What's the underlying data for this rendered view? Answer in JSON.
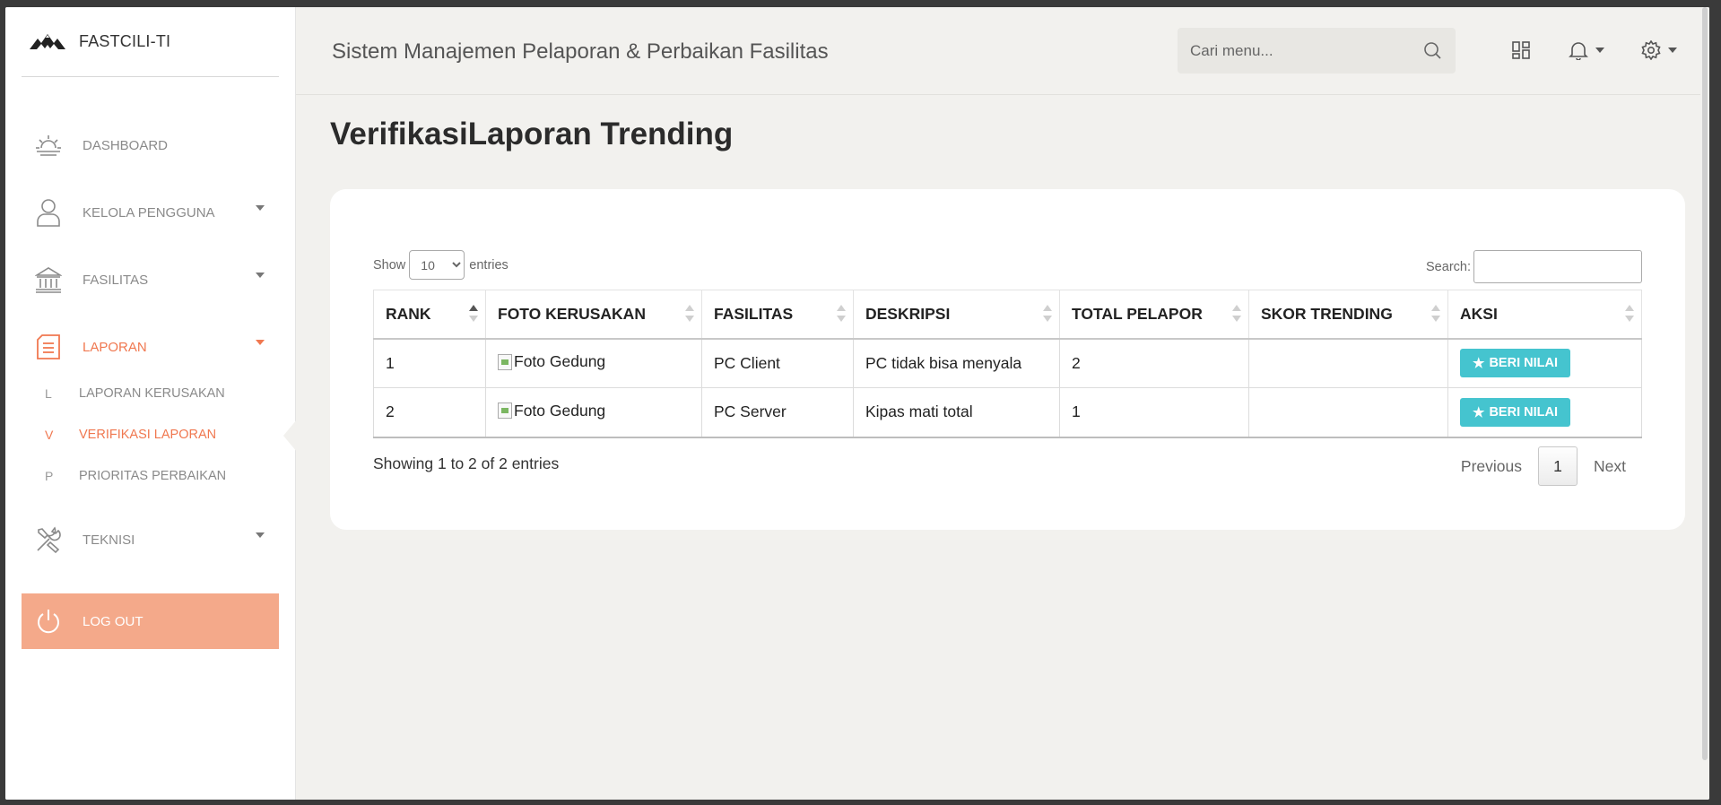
{
  "brand": {
    "name": "FASTCILI-TI",
    "logo_icon": "mountain-logo-icon"
  },
  "sidebar": {
    "items": [
      {
        "label": "DASHBOARD",
        "icon": "sunrise-icon"
      },
      {
        "label": "KELOLA PENGGUNA",
        "icon": "user-icon"
      },
      {
        "label": "FASILITAS",
        "icon": "building-icon"
      },
      {
        "label": "LAPORAN",
        "icon": "document-icon"
      },
      {
        "label": "TEKNISI",
        "icon": "tools-icon"
      }
    ],
    "sub_items": [
      {
        "letter": "L",
        "label": "LAPORAN KERUSAKAN"
      },
      {
        "letter": "V",
        "label": "VERIFIKASI LAPORAN"
      },
      {
        "letter": "P",
        "label": "PRIORITAS PERBAIKAN"
      }
    ],
    "logout_label": "LOG OUT"
  },
  "header": {
    "app_title": "Sistem Manajemen Pelaporan & Perbaikan Fasilitas",
    "search_placeholder": "Cari menu..."
  },
  "page": {
    "title": "VerifikasiLaporan Trending"
  },
  "table": {
    "length": {
      "show": "Show",
      "value": "10",
      "entries": "entries"
    },
    "search_label": "Search:",
    "columns": [
      "RANK",
      "FOTO KERUSAKAN",
      "FASILITAS",
      "DESKRIPSI",
      "TOTAL PELAPOR",
      "SKOR TRENDING",
      "AKSI"
    ],
    "rows": [
      {
        "rank": "1",
        "foto": "Foto Gedung",
        "fasilitas": "PC Client",
        "deskripsi": "PC tidak bisa menyala",
        "total": "2",
        "skor": "",
        "aksi": "BERI NILAI"
      },
      {
        "rank": "2",
        "foto": "Foto Gedung",
        "fasilitas": "PC Server",
        "deskripsi": "Kipas mati total",
        "total": "1",
        "skor": "",
        "aksi": "BERI NILAI"
      }
    ],
    "info": "Showing 1 to 2 of 2 entries",
    "pagination": {
      "previous": "Previous",
      "current": "1",
      "next": "Next"
    }
  },
  "colors": {
    "accent": "#f07850",
    "logout_bg": "#f4a98a",
    "action_button": "#45c4cf",
    "main_bg": "#f2f1ee"
  }
}
